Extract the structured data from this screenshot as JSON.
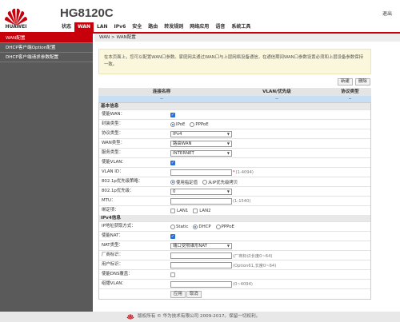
{
  "header": {
    "brand": "HUAWEI",
    "model": "HG8120C",
    "logout": "退出",
    "nav": [
      "状态",
      "WAN",
      "LAN",
      "IPv6",
      "安全",
      "路由",
      "转发规则",
      "网络应用",
      "语音",
      "系统工具"
    ],
    "active_nav": "WAN"
  },
  "sidebar": {
    "items": [
      "WAN配置",
      "DHCP客户端Option配置",
      "DHCP客户端请求参数配置"
    ],
    "active": "WAN配置"
  },
  "breadcrumb": "WAN > WAN配置",
  "notice": "在本页面上，您可以配置WAN口参数。家庭网关通过WAN口与上层网络设备通信，在通信期间WAN口参数设置必须和上层设备参数保持一致。",
  "actions": {
    "new": "新建",
    "delete": "删除"
  },
  "conn_table": {
    "headers": [
      "连接名称",
      "VLAN/优先级",
      "协议类型"
    ],
    "row": [
      "--",
      "--",
      "--"
    ]
  },
  "form": {
    "basic_title": "基本信息",
    "ipv4_title": "IPv4信息",
    "enable_wan": {
      "label": "使能WAN：",
      "checked": true
    },
    "encap": {
      "label": "封装类型：",
      "options": [
        "IPoE",
        "PPPoE"
      ],
      "selected": "IPoE"
    },
    "protocol": {
      "label": "协议类型：",
      "value": "IPv4"
    },
    "wan_mode": {
      "label": "WAN类型：",
      "value": "路由WAN"
    },
    "service": {
      "label": "服务类型：",
      "value": "INTERNET"
    },
    "enable_vlan": {
      "label": "使能VLAN：",
      "checked": true
    },
    "vlan_id": {
      "label": "VLAN ID：",
      "value": "",
      "hint": "(1-4094)"
    },
    "p8021_policy": {
      "label": "802.1p优先级策略：",
      "options": [
        "使用指定值",
        "从IP优先级拷贝"
      ],
      "selected": "使用指定值"
    },
    "p8021": {
      "label": "802.1p优先级：",
      "value": "0"
    },
    "mtu": {
      "label": "MTU：",
      "value": "",
      "hint": "(1-1540)"
    },
    "binding": {
      "label": "绑定项：",
      "options": [
        "LAN1",
        "LAN2"
      ]
    },
    "ip_mode": {
      "label": "IP地址获取方式：",
      "options": [
        "Static",
        "DHCP",
        "PPPoE"
      ],
      "selected": "DHCP"
    },
    "enable_nat": {
      "label": "使能NAT：",
      "checked": true
    },
    "nat_type": {
      "label": "NAT类型：",
      "value": "端口受限锥形NAT"
    },
    "vendor_id": {
      "label": "厂商标识：",
      "value": "",
      "hint": "(厂商标识长度0~64)"
    },
    "user_id": {
      "label": "用户标识：",
      "value": "",
      "hint": "(Option61,长度0~64)"
    },
    "dns_override": {
      "label": "使能DNS覆盖：",
      "checked": false
    },
    "multicast_vlan": {
      "label": "组播VLAN：",
      "value": "",
      "hint": "(0~4094)"
    }
  },
  "buttons": {
    "apply": "应用",
    "cancel": "取消"
  },
  "footer": "版权所有 © 华为技术有限公司 2009-2017。保留一切权利。",
  "colors": {
    "brand": "#c7000b",
    "sidebar": "#5a5a5a",
    "notice_bg": "#fbf7dc",
    "selected_row": "#c6dff4"
  }
}
